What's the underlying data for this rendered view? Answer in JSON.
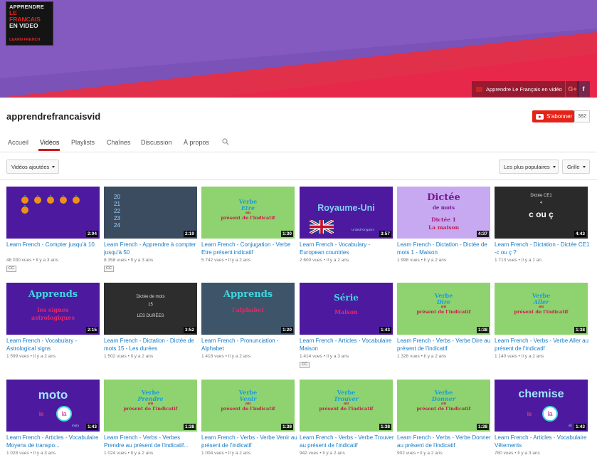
{
  "banner": {
    "logo_lines": [
      "APPRENDRE",
      "LE FRANCAIS",
      "EN VIDEO",
      "LEARN FRENCH"
    ],
    "channel_link_label": "Apprendre Le Français en vidéo",
    "social_google": "G+",
    "social_facebook": "f"
  },
  "channel": {
    "name": "apprendrefrancaisvid",
    "subscribe_label": "S'abonner",
    "subscriber_count": "382"
  },
  "tabs": {
    "home": "Accueil",
    "videos": "Vidéos",
    "playlists": "Playlists",
    "channels": "Chaînes",
    "discussion": "Discussion",
    "about": "À propos"
  },
  "filters": {
    "uploaded": "Vidéos ajoutées",
    "sort": "Les plus populaires",
    "view": "Grille"
  },
  "videos": [
    {
      "title": "Learn French - Compter jusqu'à 10",
      "views": "48 030 vues",
      "age": "Il y a 3 ans",
      "duration": "2:04",
      "cc": "CC"
    },
    {
      "title": "Learn French - Apprendre à compter jusqu'à 50",
      "views": "8 358 vues",
      "age": "Il y a 3 ans",
      "duration": "2:19",
      "cc": "CC",
      "thumb_lines": [
        "20",
        "21",
        "22",
        "23",
        "24"
      ]
    },
    {
      "title": "Learn French - Conjugation - Verbe Etre présent indicatif",
      "views": "5 742 vues",
      "age": "Il y a 2 ans",
      "duration": "1:30",
      "thumb_lines": [
        "Verbe",
        "Etre",
        "au",
        "présent de l'indicatif"
      ]
    },
    {
      "title": "Learn French - Vocabulary - European countries",
      "views": "2 600 vues",
      "age": "Il y a 2 ans",
      "duration": "3:57",
      "thumb_lines": [
        "Royaume-Uni",
        "United Kingdom"
      ]
    },
    {
      "title": "Learn French - Dictation - Dictée de mots 1 - Maison",
      "views": "1 998 vues",
      "age": "Il y a 2 ans",
      "duration": "4:37",
      "thumb_lines": [
        "Dictée",
        "de mots",
        "Dictée 1",
        "La maison"
      ]
    },
    {
      "title": "Learn French - Dictation - Dictée CE1 -c ou ç ?",
      "views": "1 713 vues",
      "age": "Il y a 1 an",
      "duration": "4:43",
      "thumb_lines": [
        "Dictée CE1",
        "4",
        "c ou ç"
      ]
    },
    {
      "title": "Learn French - Vocabulary - Astrological signs",
      "views": "1 599 vues",
      "age": "Il y a 2 ans",
      "duration": "2:15",
      "thumb_lines": [
        "Apprends",
        "les signes",
        "astrologiques"
      ]
    },
    {
      "title": "Learn French - Dictation - Dictée de mots 15 - Les durées",
      "views": "1 502 vues",
      "age": "Il y a 2 ans",
      "duration": "3:52",
      "thumb_lines": [
        "Dictée de mots",
        "15",
        "LES DURÉES"
      ]
    },
    {
      "title": "Learn French - Pronunciation - Alphabet",
      "views": "1 418 vues",
      "age": "Il y a 2 ans",
      "duration": "1:20",
      "thumb_lines": [
        "Apprends",
        "l'alphabet"
      ]
    },
    {
      "title": "Learn French - Articles - Vocabulaire Maison",
      "views": "1 414 vues",
      "age": "Il y a 3 ans",
      "duration": "1:43",
      "cc": "CC",
      "thumb_lines": [
        "Série",
        "Maison"
      ]
    },
    {
      "title": "Learn French - Verbs - Verbe Dire au présent de l'indicatif",
      "views": "1 328 vues",
      "age": "Il y a 2 ans",
      "duration": "1:38",
      "thumb_lines": [
        "Verbe",
        "Dire",
        "au",
        "présent de l'indicatif"
      ]
    },
    {
      "title": "Learn French - Verbs - Verbe Aller au présent de l'indicatif",
      "views": "1 140 vues",
      "age": "Il y a 2 ans",
      "duration": "1:38",
      "thumb_lines": [
        "Verbe",
        "Aller",
        "au",
        "présent de l'indicatif"
      ]
    },
    {
      "title": "Learn French - Articles - Vocabulaire Moyens de transpo...",
      "views": "1 028 vues",
      "age": "Il y a 3 ans",
      "duration": "1:43",
      "thumb_lines": [
        "moto",
        "le",
        "la",
        "moto"
      ]
    },
    {
      "title": "Learn French - Verbs - Verbes Prendre au présent de l'indicatif...",
      "views": "1 024 vues",
      "age": "Il y a 2 ans",
      "duration": "1:38",
      "thumb_lines": [
        "Verbe",
        "Prendre",
        "au",
        "présent de l'indicatif"
      ]
    },
    {
      "title": "Learn French - Verbs - Verbe Venir au présent de l'indicatif",
      "views": "1 004 vues",
      "age": "Il y a 2 ans",
      "duration": "1:38",
      "thumb_lines": [
        "Verbe",
        "Venir",
        "au",
        "présent de l'indicatif"
      ]
    },
    {
      "title": "Learn French - Verbs - Verbe Trouver au présent de l'indicatif",
      "views": "942 vues",
      "age": "Il y a 2 ans",
      "duration": "1:38",
      "thumb_lines": [
        "Verbe",
        "Trouver",
        "au",
        "présent de l'indicatif"
      ]
    },
    {
      "title": "Learn French - Verbs - Verbe Donner au présent de l'indicatif",
      "views": "902 vues",
      "age": "Il y a 2 ans",
      "duration": "1:38",
      "thumb_lines": [
        "Verbe",
        "Donner",
        "au",
        "présent de l'indicatif"
      ]
    },
    {
      "title": "Learn French - Articles - Vocabulaire Vêtements",
      "views": "780 vues",
      "age": "Il y a 3 ans",
      "duration": "1:43",
      "thumb_lines": [
        "chemise",
        "le",
        "la",
        "sh"
      ]
    }
  ],
  "meta_separator": "•",
  "colors": {
    "link": "#167ac6",
    "subscribe": "#e62117",
    "banner_purple": "#7a4fb5",
    "banner_red": "#e0304a",
    "thumb_green": "#8ed36f",
    "thumb_purple": "#4d1a9f"
  }
}
